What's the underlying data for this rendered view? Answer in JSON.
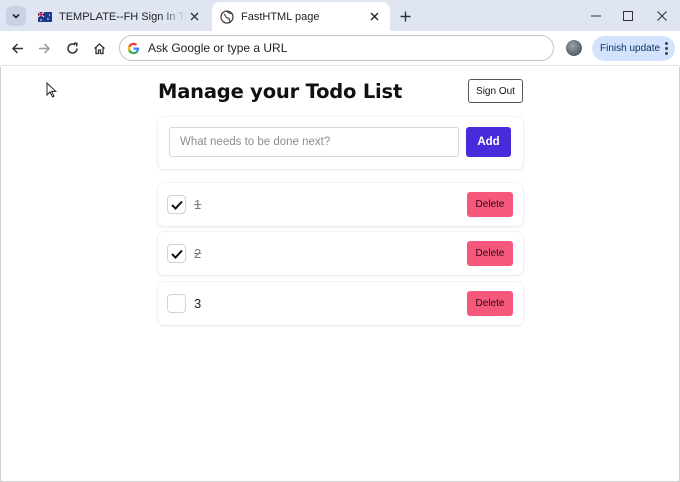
{
  "browser": {
    "tabs": [
      {
        "title": "TEMPLATE--FH Sign In Template",
        "active": false
      },
      {
        "title": "FastHTML page",
        "active": true
      }
    ],
    "omnibox_placeholder": "Ask Google or type a URL",
    "finish_update_label": "Finish update"
  },
  "page": {
    "title": "Manage your Todo List",
    "sign_out_label": "Sign Out",
    "new_todo": {
      "placeholder": "What needs to be done next?",
      "value": ""
    },
    "add_label": "Add",
    "delete_label": "Delete",
    "todos": [
      {
        "label": "1",
        "done": true
      },
      {
        "label": "2",
        "done": true
      },
      {
        "label": "3",
        "done": false
      }
    ]
  },
  "colors": {
    "add_button": "#4a2bdc",
    "delete_button": "#f6587b",
    "update_chip": "#d3e3fd",
    "tabstrip": "#dfe6f1"
  },
  "icons": [
    "chevron-down-icon",
    "flag-icon",
    "globe-icon",
    "close-icon",
    "plus-icon",
    "minimize-icon",
    "maximize-icon",
    "back-icon",
    "forward-icon",
    "reload-icon",
    "home-icon",
    "google-icon",
    "kebab-menu-icon",
    "check-icon",
    "cursor-icon"
  ]
}
